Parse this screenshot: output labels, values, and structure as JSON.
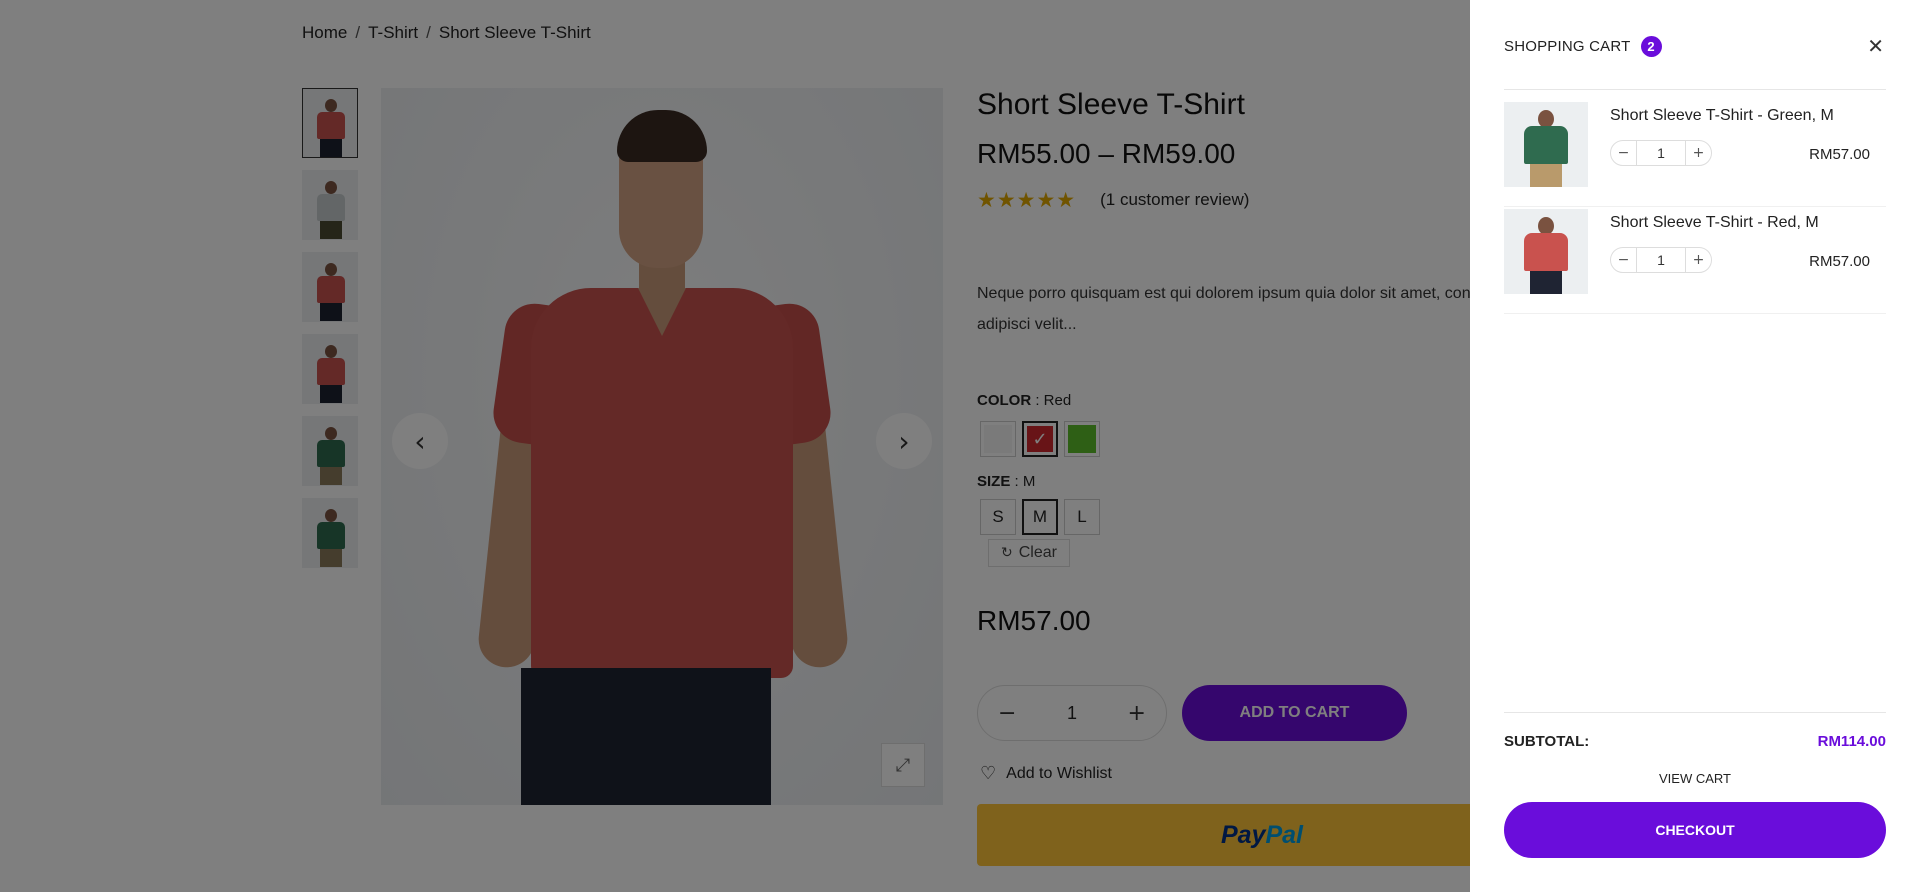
{
  "breadcrumb": {
    "items": [
      "Home",
      "T-Shirt",
      "Short Sleeve T-Shirt"
    ],
    "separator": "/"
  },
  "gallery": {
    "thumbnails": [
      {
        "shirt_color": "#c9524e",
        "pants": "dark"
      },
      {
        "shirt_color": "#c7cdcf",
        "pants": "olive"
      },
      {
        "shirt_color": "#c9524e",
        "pants": "dark"
      },
      {
        "shirt_color": "#c9524e",
        "pants": "dark"
      },
      {
        "shirt_color": "#2f6b4f",
        "pants": "khaki"
      },
      {
        "shirt_color": "#2f6b4f",
        "pants": "khaki"
      }
    ],
    "active_index": 0,
    "prev_icon": "chevron-left-icon",
    "next_icon": "chevron-right-icon",
    "zoom_icon": "expand-icon"
  },
  "product": {
    "title": "Short Sleeve T-Shirt",
    "price_range": "RM55.00 – RM59.00",
    "rating": 5,
    "review_text": "(1 customer review)",
    "description": "Neque porro quisquam est qui dolorem ipsum quia dolor sit amet, consectetur, adipisci velit...",
    "color_label": "COLOR",
    "color_value": ": Red",
    "colors": [
      {
        "name": "White",
        "hex": "#f4f4f4",
        "selected": false
      },
      {
        "name": "Red",
        "hex": "#d0282f",
        "selected": true
      },
      {
        "name": "Green",
        "hex": "#5cbf2a",
        "selected": false
      }
    ],
    "size_label": "SIZE",
    "size_value": ": M",
    "sizes": [
      {
        "label": "S",
        "selected": false
      },
      {
        "label": "M",
        "selected": true
      },
      {
        "label": "L",
        "selected": false
      }
    ],
    "clear_label": "Clear",
    "selected_price": "RM57.00",
    "quantity": "1",
    "add_to_cart_label": "ADD TO CART",
    "wishlist_label": "Add to Wishlist",
    "paypal_pay": "Pay",
    "paypal_pal": "Pal"
  },
  "cart": {
    "title": "SHOPPING CART",
    "count": "2",
    "items": [
      {
        "name": "Short Sleeve T-Shirt - Green, M",
        "qty": "1",
        "price": "RM57.00",
        "shirt_color": "#2f6b4f",
        "pants_color": "#b99a6b"
      },
      {
        "name": "Short Sleeve T-Shirt - Red, M",
        "qty": "1",
        "price": "RM57.00",
        "shirt_color": "#c9524e",
        "pants_color": "#1f2433"
      }
    ],
    "subtotal_label": "SUBTOTAL:",
    "subtotal_value": "RM114.00",
    "view_cart_label": "VIEW CART",
    "checkout_label": "CHECKOUT"
  },
  "colors": {
    "accent": "#6a0ddb",
    "rating_star": "#e0a800",
    "paypal_yellow": "#ffc439"
  }
}
